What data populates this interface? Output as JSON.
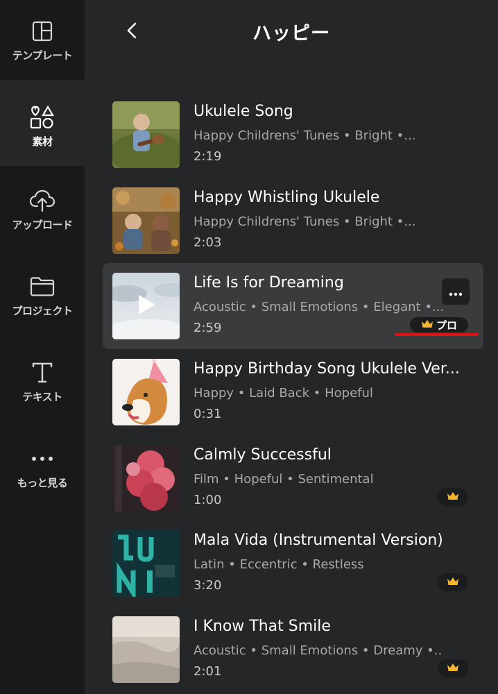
{
  "sidebar": {
    "items": [
      {
        "label": "テンプレート",
        "icon": "template-layout-icon"
      },
      {
        "label": "素材",
        "icon": "elements-shapes-icon"
      },
      {
        "label": "アップロード",
        "icon": "cloud-upload-icon"
      },
      {
        "label": "プロジェクト",
        "icon": "folder-icon"
      },
      {
        "label": "テキスト",
        "icon": "text-T-icon"
      },
      {
        "label": "もっと見る",
        "icon": "more-dots-icon"
      }
    ],
    "active_index": 1
  },
  "header": {
    "title": "ハッピー",
    "back_icon": "chevron-left-icon"
  },
  "tracks": [
    {
      "title": "Ukulele Song",
      "subtitle": "Happy Childrens' Tunes • Bright •...",
      "duration": "2:19",
      "badge": "none"
    },
    {
      "title": "Happy Whistling Ukulele",
      "subtitle": "Happy Childrens' Tunes • Bright •...",
      "duration": "2:03",
      "badge": "none"
    },
    {
      "title": "Life Is for Dreaming",
      "subtitle": "Acoustic • Small Emotions • Elegant •...",
      "duration": "2:59",
      "badge": "pro",
      "badge_label": "プロ",
      "hovered": true
    },
    {
      "title": "Happy Birthday Song Ukulele Ver...",
      "subtitle": "Happy • Laid Back • Hopeful",
      "duration": "0:31",
      "badge": "none"
    },
    {
      "title": "Calmly Successful",
      "subtitle": "Film • Hopeful • Sentimental",
      "duration": "1:00",
      "badge": "crown"
    },
    {
      "title": "Mala Vida (Instrumental Version)",
      "subtitle": "Latin • Eccentric • Restless",
      "duration": "3:20",
      "badge": "crown"
    },
    {
      "title": "I Know That Smile",
      "subtitle": "Acoustic • Small Emotions • Dreamy •...",
      "duration": "2:01",
      "badge": "crown"
    }
  ],
  "colors": {
    "background": "#252627",
    "sidebar": "#18191b",
    "hover_row": "#3a3b3d",
    "crown": "#f5b531",
    "annotation_red": "#e01010"
  }
}
